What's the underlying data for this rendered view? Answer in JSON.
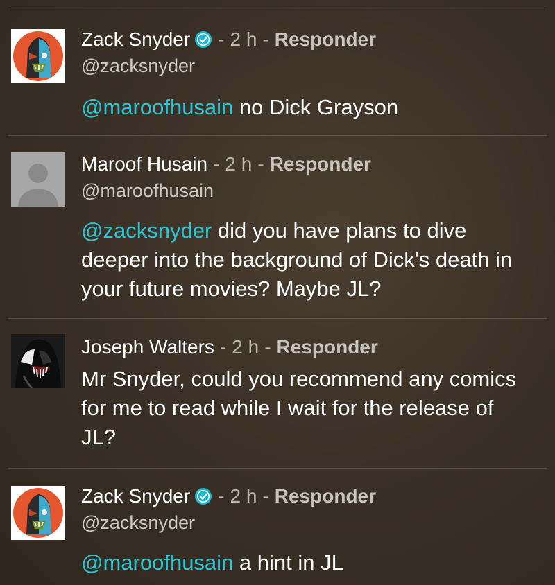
{
  "separator": "-",
  "comments": [
    {
      "author": "Zack Snyder",
      "verified": true,
      "age": "2 h",
      "reply_label": "Responder",
      "handle": "@zacksnyder",
      "mention": "@maroofhusain",
      "text": " no Dick Grayson",
      "avatar_icon": "comic-character-avatar"
    },
    {
      "author": "Maroof Husain",
      "verified": false,
      "age": "2 h",
      "reply_label": "Responder",
      "handle": "@maroofhusain",
      "mention": "@zacksnyder",
      "text": " did you have plans to dive deeper into the background of Dick's death in your future movies? Maybe JL?",
      "avatar_icon": "default-user-avatar"
    },
    {
      "author": "Joseph Walters",
      "verified": false,
      "age": "2 h",
      "reply_label": "Responder",
      "handle": "",
      "mention": "",
      "text": "Mr Snyder, could you recommend any comics for me to read while I wait for the release of JL?",
      "avatar_icon": "venom-avatar"
    },
    {
      "author": "Zack Snyder",
      "verified": true,
      "age": "2 h",
      "reply_label": "Responder",
      "handle": "@zacksnyder",
      "mention": "@maroofhusain",
      "text": " a hint in JL",
      "avatar_icon": "comic-character-avatar"
    }
  ],
  "colors": {
    "mention": "#2ec5d2",
    "verified_badge": "#1fb6cf",
    "background": "#3b3126"
  }
}
